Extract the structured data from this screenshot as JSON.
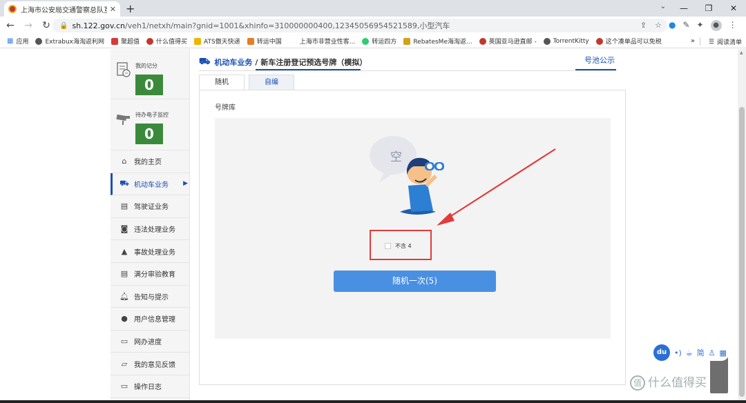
{
  "browser": {
    "tab_title": "上海市公安局交通警察总队互联网",
    "url_host": "sh.122.gov.cn",
    "url_path": "/veh1/netxh/main?gnid=1001&xhinfo=310000000400,12345056954521589,小型汽车",
    "bookmarks": [
      "应用",
      "Extrabux海淘返利网",
      "聚超值",
      "什么值得买",
      "ATS傲天快递",
      "转运中国",
      "上海市非营业性客...",
      "转运四方",
      "RebatesMe海淘返...",
      "英国亚马逊直邮 -",
      "TorrentKitty",
      "这个凑单品可以免税"
    ],
    "bookmarks_more": "»",
    "reading_list": "阅读清单",
    "bookmark_colors": [
      "#3b6fd6",
      "#555555",
      "#d63b3b",
      "#c0392b",
      "#f0b400",
      "#e67e22",
      "#ffffff",
      "#2ecc71",
      "#d4a017",
      "#c0392b",
      "#555555",
      "#c0392b"
    ]
  },
  "sidebar": {
    "score_label": "我的记分",
    "score_value": "0",
    "monitor_label": "待办电子监控",
    "monitor_value": "0",
    "items": [
      {
        "label": "我的主页",
        "icon": "home-icon"
      },
      {
        "label": "机动车业务",
        "icon": "truck-icon",
        "active": true
      },
      {
        "label": "驾驶证业务",
        "icon": "id-card-icon"
      },
      {
        "label": "违法处理业务",
        "icon": "camera-icon"
      },
      {
        "label": "事故处理业务",
        "icon": "warning-icon"
      },
      {
        "label": "满分审验教育",
        "icon": "list-icon"
      },
      {
        "label": "告知与提示",
        "icon": "bell-icon"
      },
      {
        "label": "用户信息管理",
        "icon": "user-icon"
      },
      {
        "label": "网办进度",
        "icon": "progress-icon"
      },
      {
        "label": "我的意见反馈",
        "icon": "feedback-icon"
      },
      {
        "label": "操作日志",
        "icon": "log-icon"
      }
    ]
  },
  "main": {
    "breadcrumb_section": "机动车业务",
    "breadcrumb_sep": "/",
    "breadcrumb_page": "新车注册登记预选号牌（模拟）",
    "pool_link": "号池公示",
    "tabs": [
      "随机",
      "自编"
    ],
    "panel_label": "号牌库",
    "empty_char": "空",
    "checkbox_label": "不含 4",
    "random_button": "随机一次(5)"
  },
  "widget": {
    "logo": "du",
    "simplified": "简"
  },
  "watermark": {
    "logo": "值",
    "text": "什么值得买"
  },
  "colors": {
    "accent": "#1a4fb3",
    "score_green": "#3b8a3b",
    "button_blue": "#4a90e2",
    "annotation_red": "#e23a3a"
  }
}
